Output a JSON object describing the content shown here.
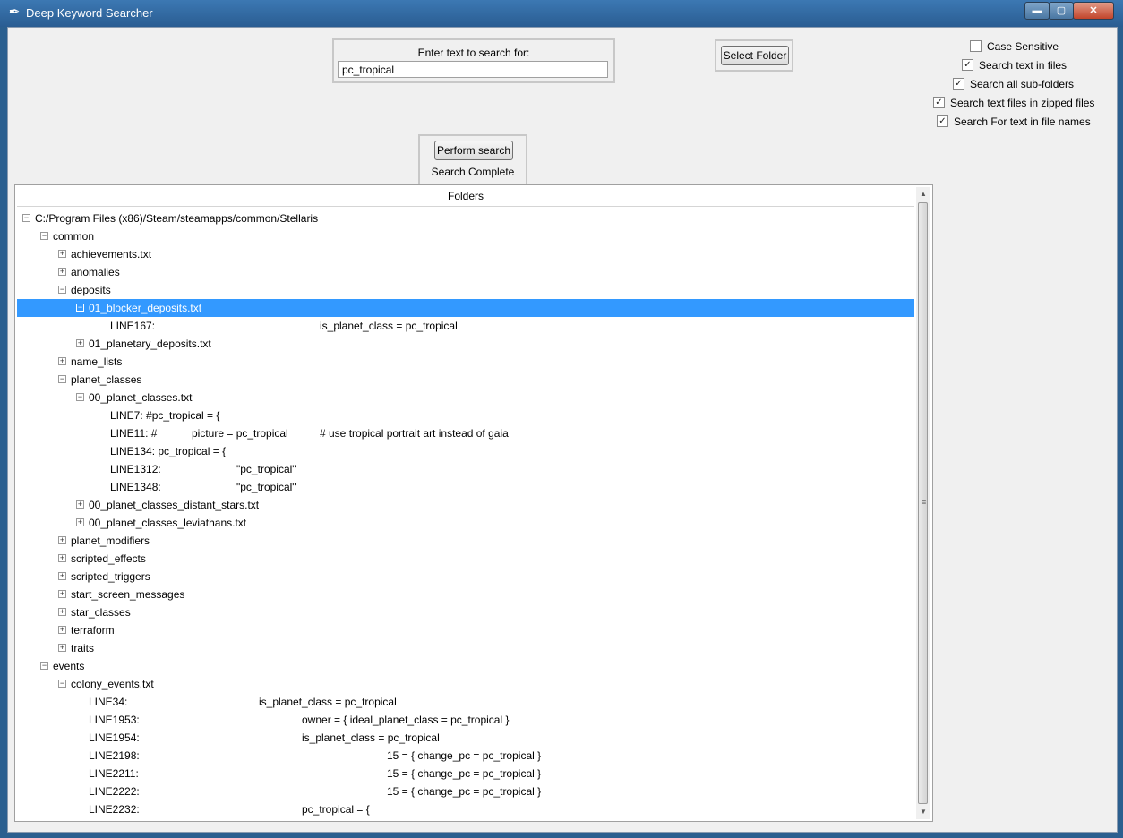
{
  "window": {
    "title": "Deep Keyword Searcher",
    "min_glyph": "▬",
    "max_glyph": "▢",
    "close_glyph": "✕"
  },
  "search": {
    "label": "Enter text to search for:",
    "value": "pc_tropical"
  },
  "select_folder_label": "Select Folder",
  "perform_label": "Perform search",
  "status": "Search Complete",
  "options": [
    {
      "label": "Case Sensitive",
      "checked": false
    },
    {
      "label": "Search text in files",
      "checked": true
    },
    {
      "label": "Search all sub-folders",
      "checked": true
    },
    {
      "label": "Search text files in zipped files",
      "checked": true
    },
    {
      "label": "Search For text in file names",
      "checked": true
    }
  ],
  "tree": {
    "header": "Folders",
    "rows": [
      {
        "lvl": 0,
        "toggle": "minus",
        "text": "C:/Program Files (x86)/Steam/steamapps/common/Stellaris"
      },
      {
        "lvl": 1,
        "toggle": "minus",
        "text": "common"
      },
      {
        "lvl": 2,
        "toggle": "plus",
        "text": "achievements.txt"
      },
      {
        "lvl": 2,
        "toggle": "plus",
        "text": "anomalies"
      },
      {
        "lvl": 2,
        "toggle": "minus",
        "text": "deposits"
      },
      {
        "lvl": 3,
        "toggle": "minus",
        "text": "01_blocker_deposits.txt",
        "selected": true
      },
      {
        "lvl": 4,
        "text": "LINE167:",
        "m1": "is_planet_class = pc_tropical"
      },
      {
        "lvl": 3,
        "toggle": "plus",
        "text": "01_planetary_deposits.txt"
      },
      {
        "lvl": 2,
        "toggle": "plus",
        "text": "name_lists"
      },
      {
        "lvl": 2,
        "toggle": "minus",
        "text": "planet_classes"
      },
      {
        "lvl": 3,
        "toggle": "minus",
        "text": "00_planet_classes.txt"
      },
      {
        "lvl": 4,
        "text": "LINE7:  #pc_tropical = {"
      },
      {
        "lvl": 4,
        "text": "LINE11:  #",
        "m2": "picture = pc_tropical",
        "m3": "# use tropical portrait art instead of gaia"
      },
      {
        "lvl": 4,
        "text": "LINE134:  pc_tropical = {"
      },
      {
        "lvl": 4,
        "text": "LINE1312:",
        "m1": "\"pc_tropical\""
      },
      {
        "lvl": 4,
        "text": "LINE1348:",
        "m1": "\"pc_tropical\""
      },
      {
        "lvl": 3,
        "toggle": "plus",
        "text": "00_planet_classes_distant_stars.txt"
      },
      {
        "lvl": 3,
        "toggle": "plus",
        "text": "00_planet_classes_leviathans.txt"
      },
      {
        "lvl": 2,
        "toggle": "plus",
        "text": "planet_modifiers"
      },
      {
        "lvl": 2,
        "toggle": "plus",
        "text": "scripted_effects"
      },
      {
        "lvl": 2,
        "toggle": "plus",
        "text": "scripted_triggers"
      },
      {
        "lvl": 2,
        "toggle": "plus",
        "text": "start_screen_messages"
      },
      {
        "lvl": 2,
        "toggle": "plus",
        "text": "star_classes"
      },
      {
        "lvl": 2,
        "toggle": "plus",
        "text": "terraform"
      },
      {
        "lvl": 2,
        "toggle": "plus",
        "text": "traits"
      },
      {
        "lvl": 1,
        "toggle": "minus",
        "text": "events"
      },
      {
        "lvl": 2,
        "toggle": "minus",
        "text": "colony_events.txt"
      },
      {
        "lvl": 3,
        "text": "LINE34:",
        "m1": "is_planet_class = pc_tropical"
      },
      {
        "lvl": 3,
        "text": "LINE1953:",
        "m1": "owner = { ideal_planet_class = pc_tropical }"
      },
      {
        "lvl": 3,
        "text": "LINE1954:",
        "m1": "is_planet_class = pc_tropical"
      },
      {
        "lvl": 3,
        "text": "LINE2198:",
        "m1": "15 = { change_pc = pc_tropical }"
      },
      {
        "lvl": 3,
        "text": "LINE2211:",
        "m1": "15 = { change_pc = pc_tropical }"
      },
      {
        "lvl": 3,
        "text": "LINE2222:",
        "m1": "15 = { change_pc = pc_tropical }"
      },
      {
        "lvl": 3,
        "text": "LINE2232:",
        "m1": "pc_tropical = {"
      }
    ]
  },
  "colors": {
    "selection": "#3399ff",
    "titlebar": "#2a5d92"
  }
}
